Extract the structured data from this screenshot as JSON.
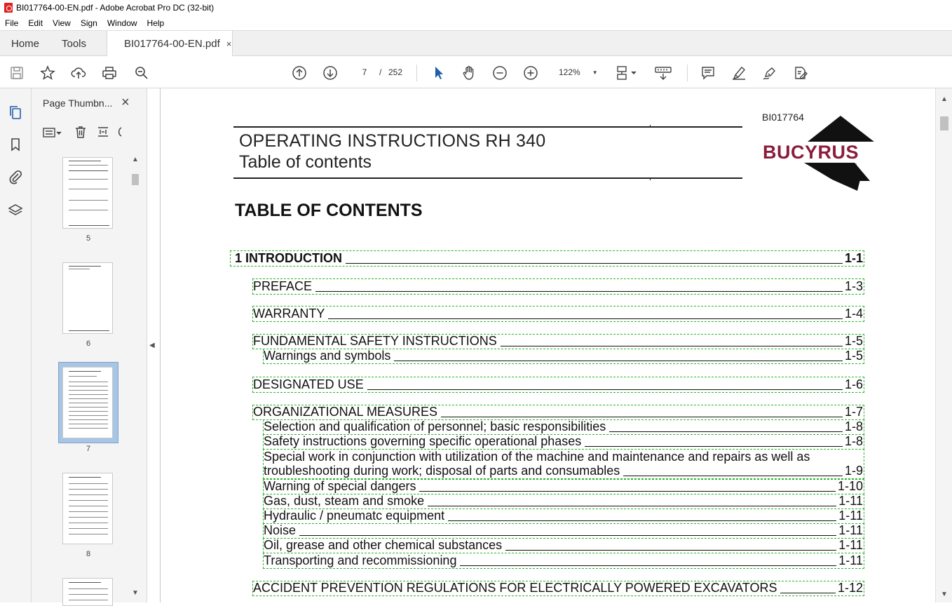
{
  "window": {
    "title": "BI017764-00-EN.pdf - Adobe Acrobat Pro DC (32-bit)"
  },
  "menu": [
    "File",
    "Edit",
    "View",
    "Sign",
    "Window",
    "Help"
  ],
  "tabs": {
    "home": "Home",
    "tools": "Tools",
    "document": "BI017764-00-EN.pdf",
    "close": "×"
  },
  "toolbar": {
    "page_current": "7",
    "page_sep": "/",
    "page_total": "252",
    "zoom": "122%"
  },
  "thumbnails_panel": {
    "title": "Page Thumbn...",
    "pages": [
      {
        "number": "5"
      },
      {
        "number": "6"
      },
      {
        "number": "7",
        "selected": true
      },
      {
        "number": "8"
      }
    ]
  },
  "document": {
    "code": "BI017764",
    "header_title": "OPERATING INSTRUCTIONS RH 340",
    "header_subtitle": "Table of contents",
    "toc_heading": "TABLE OF CONTENTS",
    "logo_text": "BUCYRUS",
    "toc": [
      {
        "text": "1   INTRODUCTION",
        "page": "1-1",
        "bold": true
      },
      {
        "text": "PREFACE",
        "page": "1-3"
      },
      {
        "text": "WARRANTY",
        "page": "1-4"
      },
      {
        "text": "FUNDAMENTAL SAFETY INSTRUCTIONS",
        "page": "1-5"
      },
      {
        "text": "Warnings and symbols",
        "page": "1-5"
      },
      {
        "text": "DESIGNATED USE",
        "page": "1-6"
      },
      {
        "text": "ORGANIZATIONAL MEASURES",
        "page": "1-7"
      },
      {
        "text": "Selection and qualification of personnel; basic responsibilities",
        "page": "1-8"
      },
      {
        "text": "Safety instructions governing specific operational phases",
        "page": "1-8"
      },
      {
        "text": "Special work in conjunction with utilization of the machine and maintenance and repairs as well as",
        "text2": "troubleshooting during work; disposal of parts and consumables",
        "page": "1-9"
      },
      {
        "text": "Warning of special dangers",
        "page": "1-10"
      },
      {
        "text": "Gas, dust, steam and smoke",
        "page": "1-11"
      },
      {
        "text": "Hydraulic / pneumatc equipment",
        "page": "1-11"
      },
      {
        "text": "Noise",
        "page": "1-11"
      },
      {
        "text": "Oil, grease and other chemical substances",
        "page": "1-11"
      },
      {
        "text": "Transporting and recommissioning",
        "page": "1-11"
      },
      {
        "text": "ACCIDENT PREVENTION REGULATIONS FOR ELECTRICALLY POWERED EXCAVATORS",
        "page": "1-12"
      }
    ]
  },
  "colors": {
    "accent_blue": "#1f5fa8",
    "logo_red": "#8b1c3c",
    "selection": "#a8c6e4"
  }
}
